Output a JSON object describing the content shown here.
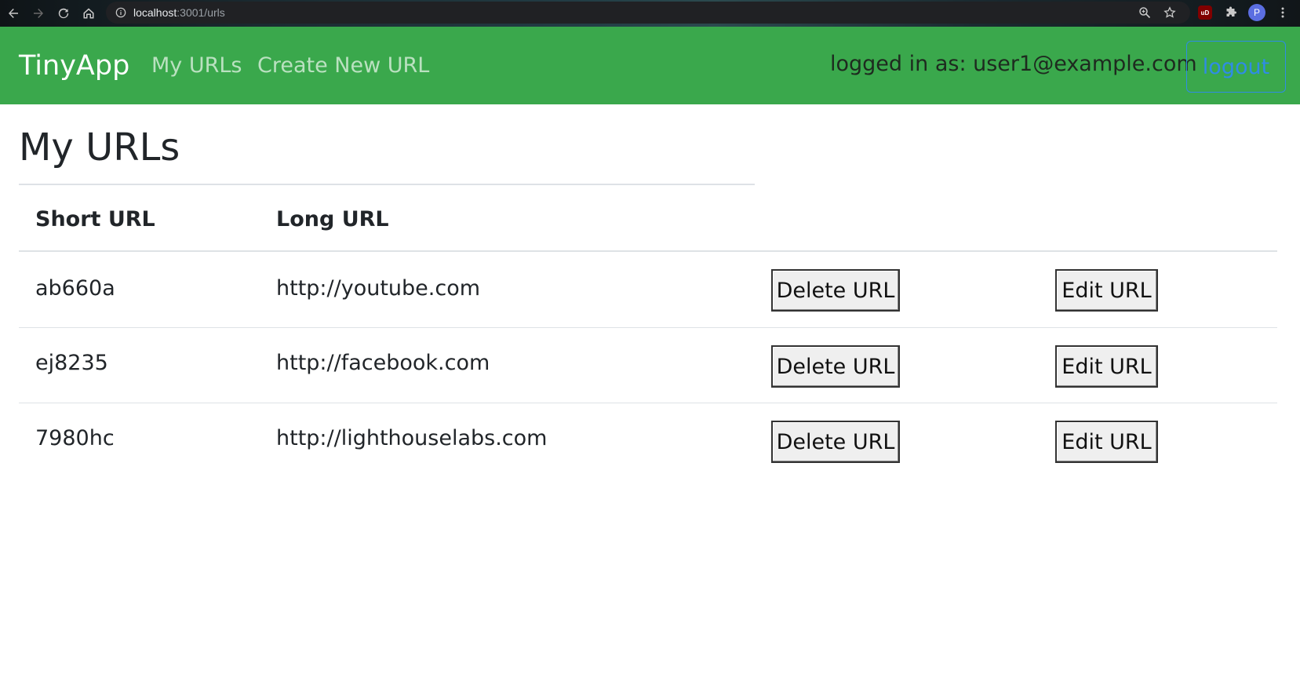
{
  "browser": {
    "url_host": "localhost",
    "url_path": ":3001/urls",
    "profile_initial": "P",
    "ublock_label": "uD"
  },
  "navbar": {
    "brand": "TinyApp",
    "links": {
      "my_urls": "My URLs",
      "create_new_url": "Create New URL"
    },
    "logged_in_text": "logged in as: user1@example.com",
    "logout_label": "logout",
    "background_color": "#3aa84c",
    "logout_color": "#2f8ce6"
  },
  "main": {
    "title": "My URLs",
    "table": {
      "headers": {
        "short_url": "Short URL",
        "long_url": "Long URL"
      },
      "rows": [
        {
          "short_url": "ab660a",
          "long_url": "http://youtube.com",
          "delete_label": "Delete URL",
          "edit_label": "Edit URL"
        },
        {
          "short_url": "ej8235",
          "long_url": "http://facebook.com",
          "delete_label": "Delete URL",
          "edit_label": "Edit URL"
        },
        {
          "short_url": "7980hc",
          "long_url": "http://lighthouselabs.com",
          "delete_label": "Delete URL",
          "edit_label": "Edit URL"
        }
      ]
    }
  },
  "icons": {
    "back": "arrow-left-icon",
    "forward": "arrow-right-icon",
    "reload": "reload-icon",
    "home": "home-icon",
    "info": "info-icon",
    "zoom": "zoom-icon",
    "bookmark": "star-icon",
    "extensions": "puzzle-icon",
    "menu": "kebab-menu-icon"
  }
}
